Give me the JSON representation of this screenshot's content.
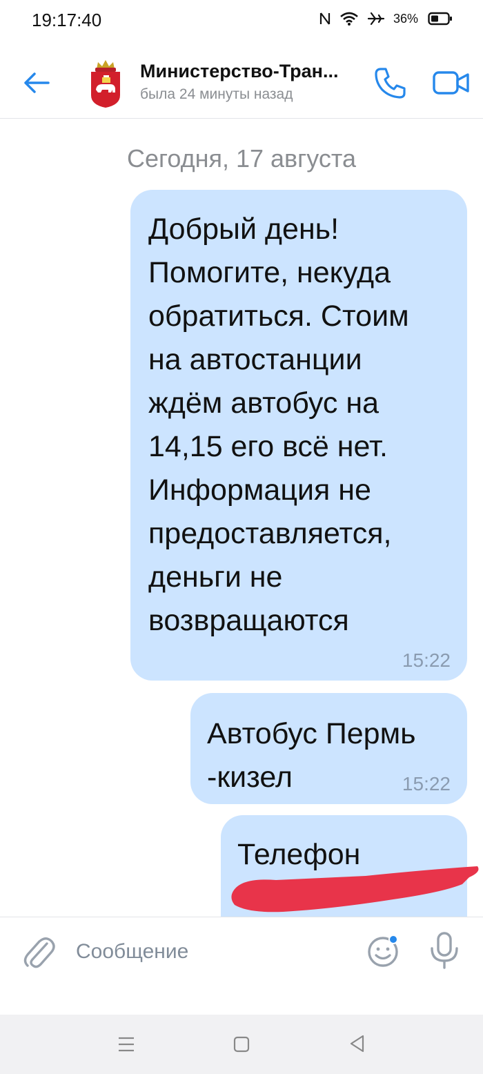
{
  "status_bar": {
    "time": "19:17:40",
    "battery": "36%",
    "icons": [
      "nfc-icon",
      "wifi-icon",
      "airplane-icon",
      "battery-icon"
    ]
  },
  "header": {
    "title": "Министерство-Тран...",
    "subtitle": "была 24 минуты назад",
    "avatar": "perm-krai-coat-of-arms",
    "accent_color": "#2688eb"
  },
  "chat": {
    "date_separator": "Сегодня, 17 августа",
    "bubble_color": "#cce4ff",
    "messages": [
      {
        "text": "Добрый день!\nПомогите, некуда\nобратиться. Стоим\nна автостанции\nждём автобус на\n14,15 его всё нет.\nИнформация не\nпредоставляется,\nденьги не\nвозвращаются",
        "time": "15:22"
      },
      {
        "text": "Автобус Пермь\n-кизел",
        "time": "15:22"
      },
      {
        "text": "Телефон",
        "redacted": true,
        "redaction_color": "#e8344a"
      }
    ]
  },
  "composer": {
    "placeholder": "Сообщение"
  },
  "nav_bar": {
    "icons": [
      "menu-icon",
      "home-icon",
      "back-icon"
    ]
  }
}
